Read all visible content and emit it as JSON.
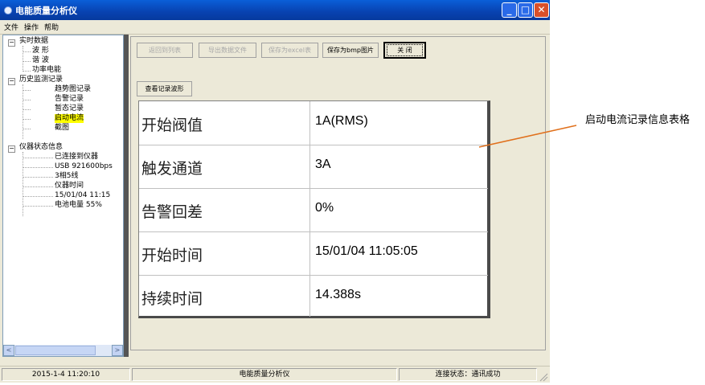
{
  "window": {
    "title": "电能质量分析仪",
    "controls": {
      "minimize": "_",
      "maximize": "□",
      "close": "✕"
    }
  },
  "menu": {
    "items": [
      "文件",
      "操作",
      "帮助"
    ]
  },
  "tree": {
    "expander_symbol": "−",
    "groups": [
      {
        "label": "实时数据",
        "children": [
          "波 形",
          "谐 波",
          "功率电能"
        ]
      },
      {
        "label": "历史监测记录",
        "children": [
          "趋势图记录",
          "告警记录",
          "暂态记录",
          "启动电流",
          "截图"
        ]
      },
      {
        "label": "仪器状态信息",
        "children": [
          "已连接到仪器",
          "USB 921600bps",
          "3相5线",
          "仪器时间",
          "15/01/04 11:15",
          "电池电量 55%"
        ]
      }
    ],
    "selected": "启动电流",
    "scroll_left": "<",
    "scroll_right": ">"
  },
  "toolbar": {
    "back_label": "返回到列表",
    "export_label": "导出数据文件",
    "save_excel_label": "保存为excel表",
    "save_bmp_label": "保存为bmp图片",
    "close_label": "关 闭"
  },
  "view_waveform_label": "查看记录波形",
  "record_table": {
    "rows": [
      {
        "label": "开始阀值",
        "value": "1A(RMS)"
      },
      {
        "label": "触发通道",
        "value": "3A"
      },
      {
        "label": "告警回差",
        "value": "0%"
      },
      {
        "label": "开始时间",
        "value": "15/01/04 11:05:05"
      },
      {
        "label": "持续时间",
        "value": "14.388s"
      }
    ]
  },
  "statusbar": {
    "datetime": "2015-1-4 11:20:10",
    "app_name": "电能质量分析仪",
    "connection": "连接状态：通讯成功"
  },
  "annotation": {
    "text": "启动电流记录信息表格",
    "color": "#e0701c"
  }
}
